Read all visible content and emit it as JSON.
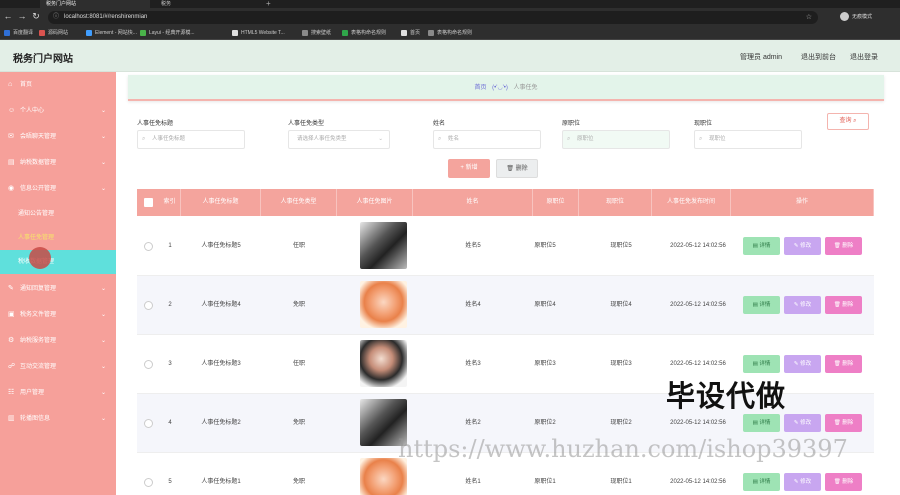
{
  "browser": {
    "tabs": [
      {
        "label": "税务门户网站",
        "active": true
      },
      {
        "label": "税务",
        "active": false
      }
    ],
    "url": "localhost:8081/#/renshirenmian",
    "profile_label": "无痕模式",
    "bookmarks": [
      {
        "label": "百度翻译",
        "color": "#2f6fd6"
      },
      {
        "label": "源码网站",
        "color": "#d9534f"
      },
      {
        "label": "Element - 网站快...",
        "color": "#409eff"
      },
      {
        "label": "Layui - 经典开源模...",
        "color": "#4ab34a"
      },
      {
        "label": "HTML5 Website T...",
        "color": "#e0e0e0"
      },
      {
        "label": "搜索壁纸",
        "color": "#8a8a8a"
      },
      {
        "label": "表格构命名规则",
        "color": "#2fa64a"
      },
      {
        "label": "首页",
        "color": "#e0e0e0"
      },
      {
        "label": "表格构命名规则",
        "color": "#8a8a8a"
      }
    ]
  },
  "header": {
    "title": "税务门户网站",
    "user_label": "管理员 admin",
    "back_label": "退出到前台",
    "logout_label": "退出登录"
  },
  "sidebar": {
    "items": [
      {
        "label": "首页",
        "icon": "home-icon",
        "expandable": false
      },
      {
        "label": "个人中心",
        "icon": "user-icon",
        "expandable": true
      },
      {
        "label": "会晤聊天管理",
        "icon": "chat-icon",
        "expandable": true
      },
      {
        "label": "纳税数据管理",
        "icon": "data-icon",
        "expandable": true
      },
      {
        "label": "信息公开管理",
        "icon": "info-icon",
        "expandable": true
      },
      {
        "label": "通知回复管理",
        "icon": "notice-icon",
        "expandable": true
      },
      {
        "label": "税务文件管理",
        "icon": "file-icon",
        "expandable": true
      },
      {
        "label": "纳税服务管理",
        "icon": "service-icon",
        "expandable": true
      },
      {
        "label": "互动交流管理",
        "icon": "interact-icon",
        "expandable": true
      },
      {
        "label": "用户管理",
        "icon": "users-icon",
        "expandable": true
      },
      {
        "label": "轮播图信息",
        "icon": "carousel-icon",
        "expandable": true
      }
    ],
    "subitems": [
      {
        "label": "通知公告管理",
        "state": "normal"
      },
      {
        "label": "人事任免管理",
        "state": "yellow"
      },
      {
        "label": "税收数据管理",
        "state": "active"
      }
    ]
  },
  "breadcrumb": {
    "home": "首页",
    "separator": "(•'◡'•)",
    "current": "人事任免"
  },
  "filters": {
    "title_label": "人事任免标题",
    "title_placeholder": "人事任免标题",
    "type_label": "人事任免类型",
    "type_placeholder": "请选择人事任免类型",
    "name_label": "姓名",
    "name_placeholder": "姓名",
    "origpos_label": "原职位",
    "origpos_placeholder": "原职位",
    "curpos_label": "现职位",
    "curpos_placeholder": "现职位",
    "query_label": "查询"
  },
  "toolbar": {
    "add_label": "+ 新增",
    "delete_label": "删除"
  },
  "table": {
    "columns": [
      "索引",
      "人事任免标题",
      "人事任免类型",
      "人事任免图片",
      "姓名",
      "原职位",
      "现职位",
      "人事任免发布时间",
      "操作"
    ],
    "rows": [
      {
        "index": "1",
        "title": "人事任免标题5",
        "type": "任职",
        "name": "姓名5",
        "orig": "原职位5",
        "cur": "现职位5",
        "time": "2022-05-12 14:02:56",
        "photo": "dark"
      },
      {
        "index": "2",
        "title": "人事任免标题4",
        "type": "免职",
        "name": "姓名4",
        "orig": "原职位4",
        "cur": "现职位4",
        "time": "2022-05-12 14:02:56",
        "photo": "warm"
      },
      {
        "index": "3",
        "title": "人事任免标题3",
        "type": "任职",
        "name": "姓名3",
        "orig": "原职位3",
        "cur": "现职位3",
        "time": "2022-05-12 14:02:56",
        "photo": "light"
      },
      {
        "index": "4",
        "title": "人事任免标题2",
        "type": "免职",
        "name": "姓名2",
        "orig": "原职位2",
        "cur": "现职位2",
        "time": "2022-05-12 14:02:56",
        "photo": "dark"
      },
      {
        "index": "5",
        "title": "人事任免标题1",
        "type": "免职",
        "name": "姓名1",
        "orig": "原职位1",
        "cur": "现职位1",
        "time": "2022-05-12 14:02:56",
        "photo": "warm"
      }
    ],
    "action_labels": {
      "detail": "详情",
      "edit": "修改",
      "remove": "删除"
    }
  },
  "overlay": {
    "caption": "毕设代做",
    "watermark": "https://www.huzhan.com/ishop39397"
  },
  "colors": {
    "primary": "#f4a49d",
    "sidebar": "#f6a09a",
    "active": "#5fe0dc",
    "header_bg": "#e3efe7"
  }
}
